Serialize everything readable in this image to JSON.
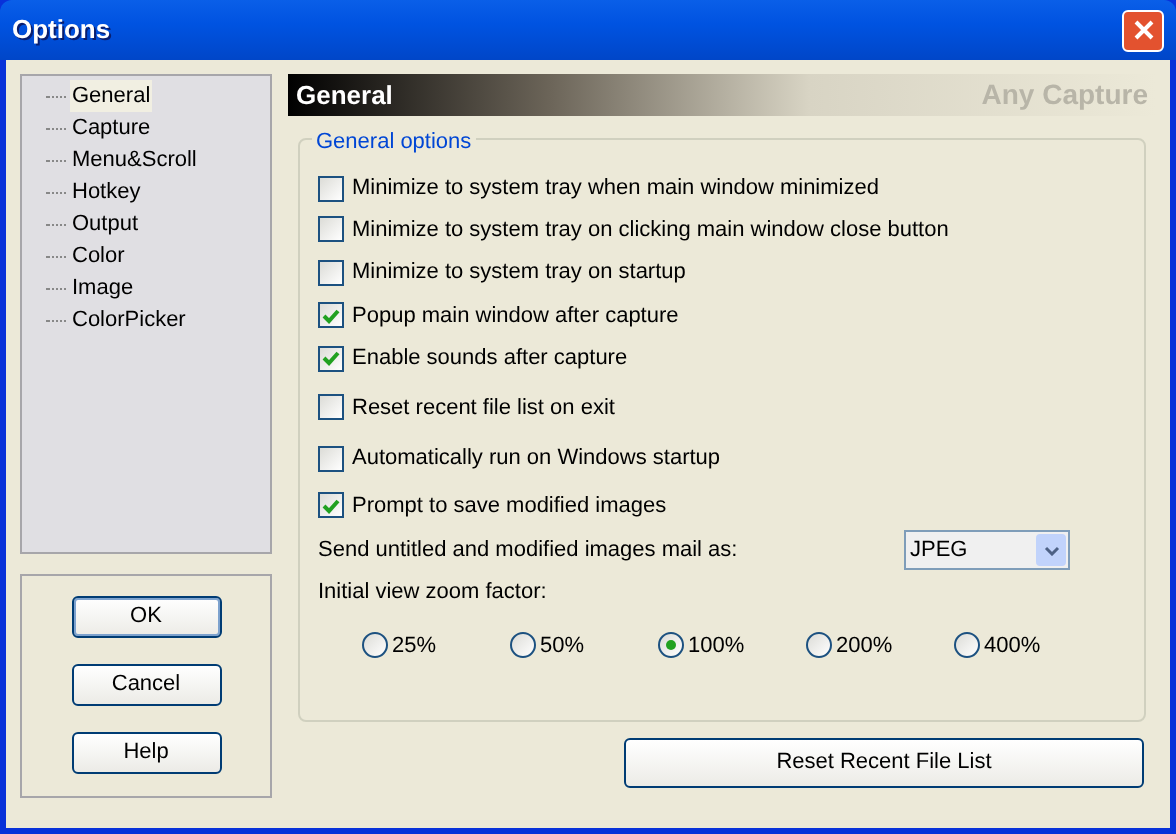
{
  "window": {
    "title": "Options"
  },
  "sidebar": {
    "items": [
      {
        "label": "General",
        "selected": true
      },
      {
        "label": "Capture",
        "selected": false
      },
      {
        "label": "Menu&Scroll",
        "selected": false
      },
      {
        "label": "Hotkey",
        "selected": false
      },
      {
        "label": "Output",
        "selected": false
      },
      {
        "label": "Color",
        "selected": false
      },
      {
        "label": "Image",
        "selected": false
      },
      {
        "label": "ColorPicker",
        "selected": false
      }
    ]
  },
  "buttons": [
    {
      "label": "OK",
      "default": true
    },
    {
      "label": "Cancel",
      "default": false
    },
    {
      "label": "Help",
      "default": false
    }
  ],
  "header": {
    "title": "General",
    "product": "Any Capture"
  },
  "group": {
    "title": "General options",
    "checkboxes": [
      {
        "label": "Minimize to system tray when main window minimized",
        "checked": false
      },
      {
        "label": "Minimize to system tray on clicking main window close button",
        "checked": false
      },
      {
        "label": "Minimize to system tray on startup",
        "checked": false
      },
      {
        "label": "Popup main window after capture",
        "checked": true
      },
      {
        "label": "Enable sounds after capture",
        "checked": true
      },
      {
        "label": "Reset recent file list on exit",
        "checked": false
      },
      {
        "label": "Automatically run on Windows startup",
        "checked": false
      },
      {
        "label": "Prompt to save modified images",
        "checked": true
      }
    ],
    "mail_format": {
      "label": "Send untitled and modified images mail as:",
      "value": "JPEG"
    },
    "zoom": {
      "label": "Initial view zoom factor:",
      "options": [
        {
          "label": "25%",
          "selected": false
        },
        {
          "label": "50%",
          "selected": false
        },
        {
          "label": "100%",
          "selected": true
        },
        {
          "label": "200%",
          "selected": false
        },
        {
          "label": "400%",
          "selected": false
        }
      ]
    }
  },
  "reset_button": {
    "label": "Reset Recent File List"
  }
}
